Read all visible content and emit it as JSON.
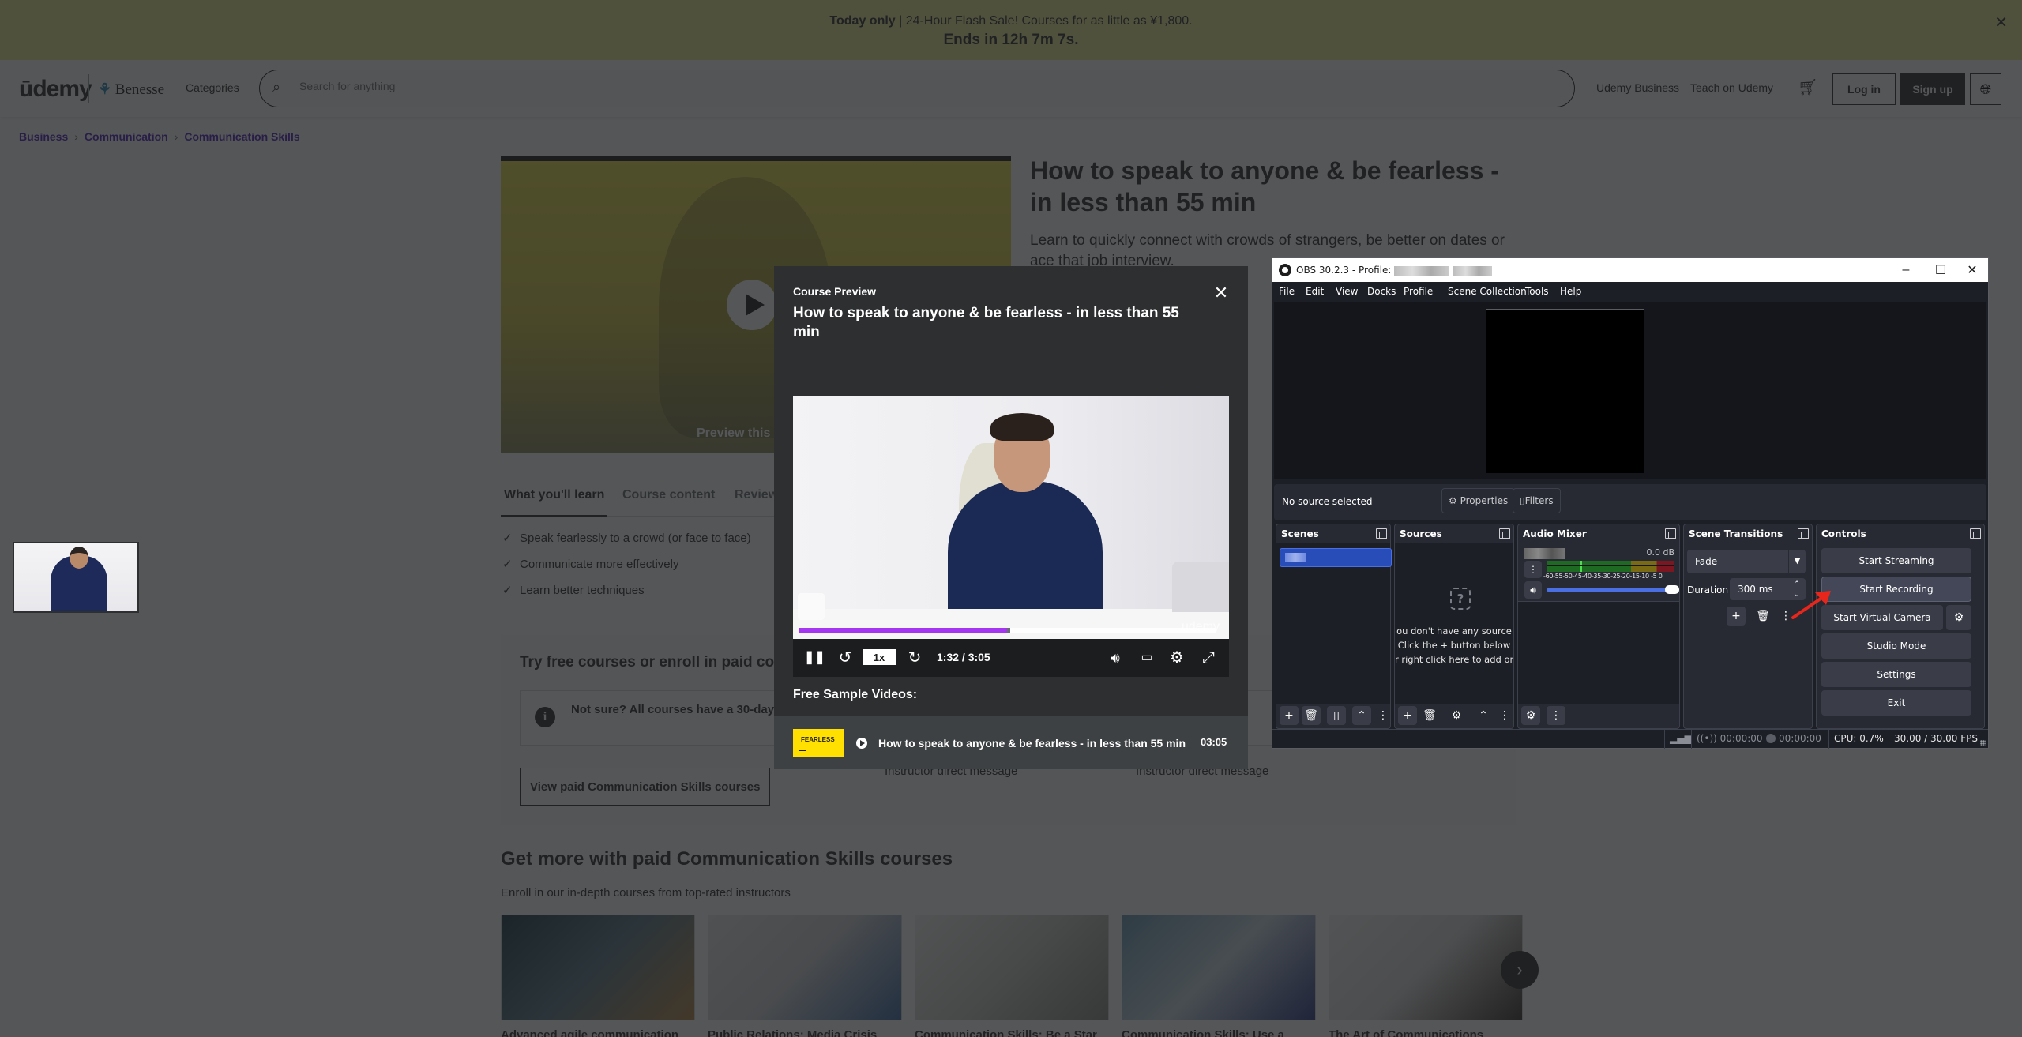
{
  "banner": {
    "bold": "Today only",
    "text": " | 24-Hour Flash Sale! Courses for as little as ¥1,800.",
    "countdown": "Ends in 12h 7m 7s.",
    "close_icon": "close-icon"
  },
  "header": {
    "logo": "ūdemy",
    "partner": "Benesse",
    "categories": "Categories",
    "search_placeholder": "Search for anything",
    "links": [
      "Udemy Business",
      "Teach on Udemy"
    ],
    "login": "Log in",
    "signup": "Sign up"
  },
  "breadcrumb": [
    "Business",
    "Communication",
    "Communication Skills"
  ],
  "course": {
    "preview_caption": "Preview this course",
    "title": "How to speak to anyone & be fearless - in less than 55 min",
    "subtitle": "Learn to quickly connect with crowds of strangers, be better on dates or ace that job interview.",
    "enroll_fragment": "Enroll",
    "tabs": [
      "What you'll learn",
      "Course content",
      "Reviews"
    ],
    "learn_items": [
      "Speak fearlessly to a crowd (or face to face)",
      "Communicate more effectively",
      "Learn better techniques"
    ],
    "try_free_heading": "Try free courses or enroll in paid courses",
    "guarantee": "Not sure? All courses have a 30-day money-back guarantee",
    "view_paid": "View paid Communication Skills courses",
    "compare_left": "Instructor direct message",
    "compare_right": "Instructor direct message"
  },
  "more": {
    "heading": "Get more with paid Communication Skills courses",
    "subheading": "Enroll in our in-depth courses from top-rated instructors",
    "cards": [
      "Advanced agile communication",
      "Public Relations: Media Crisis",
      "Communication Skills: Be a Star",
      "Communication Skills: Use a",
      "The Art of Communications"
    ]
  },
  "modal": {
    "kicker": "Course Preview",
    "title": "How to speak to anyone & be fearless - in less than 55 min",
    "player": {
      "speed": "1x",
      "time": "1:32 / 3:05",
      "progress_fraction": 0.4973,
      "watermark": "udemy"
    },
    "free_heading": "Free Sample Videos:",
    "samples": [
      {
        "thumb_label": "FEARLESS",
        "title": "How to speak to anyone & be fearless - in less than 55 min",
        "duration": "03:05"
      }
    ]
  },
  "obs": {
    "title": "OBS 30.2.3 - Profile:",
    "menu": [
      "File",
      "Edit",
      "View",
      "Docks",
      "Profile",
      "Scene Collection",
      "Tools",
      "Help"
    ],
    "no_source": "No source selected",
    "properties": "Properties",
    "filters": "Filters",
    "docks": {
      "scenes": "Scenes",
      "sources": "Sources",
      "mixer": "Audio Mixer",
      "transitions": "Scene Transitions",
      "controls": "Controls"
    },
    "sources_empty": [
      "ou don't have any source",
      "Click the + button below",
      "r right click here to add or"
    ],
    "mixer": {
      "db": "0.0 dB",
      "scale": "-60-55-50-45-40-35-30-25-20-15-10 -5  0",
      "volume_fraction": 1.0
    },
    "transition": {
      "selected": "Fade",
      "duration_label": "Duration",
      "duration": "300 ms"
    },
    "controls": [
      "Start Streaming",
      "Start Recording",
      "Start Virtual Camera",
      "Studio Mode",
      "Settings",
      "Exit"
    ],
    "status": {
      "stream_time": "00:00:00",
      "rec_time": "00:00:00",
      "cpu": "CPU: 0.7%",
      "fps": "30.00 / 30.00 FPS"
    }
  },
  "colors": {
    "udemy_purple": "#a435f0",
    "obs_selection": "#284cb8",
    "annotation_red": "#e8261c"
  }
}
